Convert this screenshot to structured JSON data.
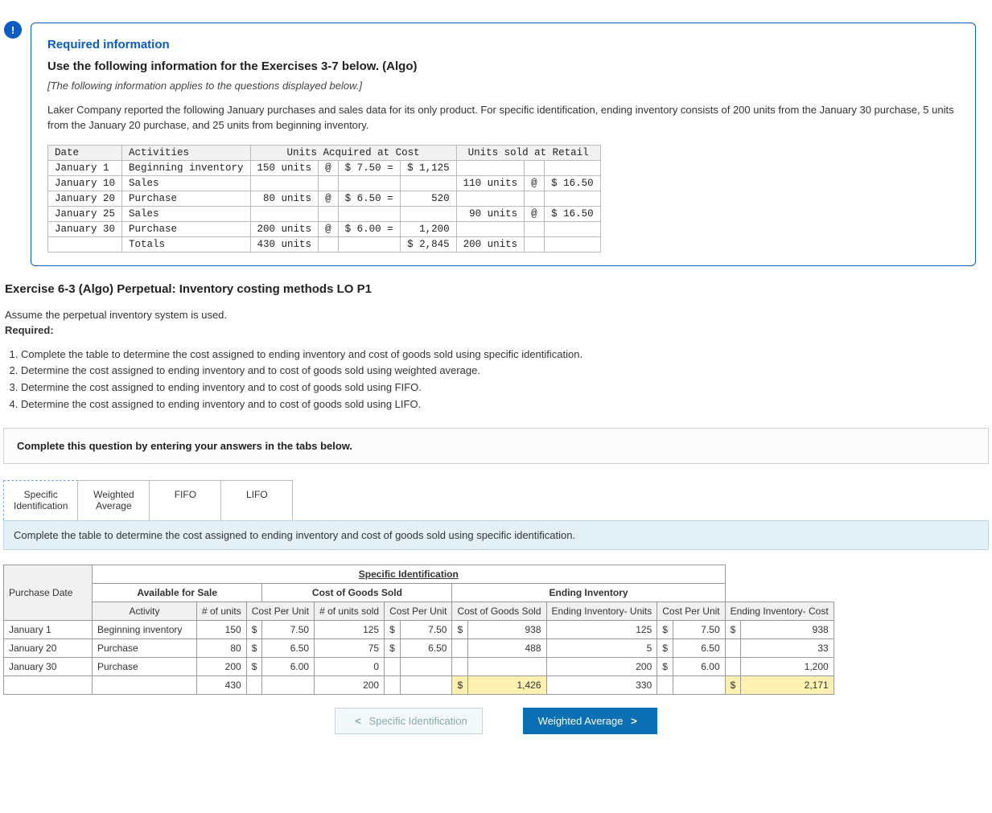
{
  "alert_glyph": "!",
  "info": {
    "required_title": "Required information",
    "use_line": "Use the following information for the Exercises 3-7 below. (Algo)",
    "italic_line": "[The following information applies to the questions displayed below.]",
    "body": "Laker Company reported the following January purchases and sales data for its only product. For specific identification, ending inventory consists of 200 units from the January 30 purchase, 5 units from the January 20 purchase, and 25 units from beginning inventory."
  },
  "source_table": {
    "head_date": "Date",
    "head_act": "Activities",
    "head_cost": "Units Acquired at Cost",
    "head_retail": "Units sold at Retail",
    "rows": [
      {
        "date": "January 1",
        "act": "Beginning inventory",
        "units": "150 units",
        "at": "@",
        "price": "$ 7.50 =",
        "total": "$ 1,125",
        "s_units": "",
        "s_at": "",
        "s_price": ""
      },
      {
        "date": "January 10",
        "act": "Sales",
        "units": "",
        "at": "",
        "price": "",
        "total": "",
        "s_units": "110 units",
        "s_at": "@",
        "s_price": "$ 16.50"
      },
      {
        "date": "January 20",
        "act": "Purchase",
        "units": "80 units",
        "at": "@",
        "price": "$ 6.50 =",
        "total": "520",
        "s_units": "",
        "s_at": "",
        "s_price": ""
      },
      {
        "date": "January 25",
        "act": "Sales",
        "units": "",
        "at": "",
        "price": "",
        "total": "",
        "s_units": "90 units",
        "s_at": "@",
        "s_price": "$ 16.50"
      },
      {
        "date": "January 30",
        "act": "Purchase",
        "units": "200 units",
        "at": "@",
        "price": "$ 6.00 =",
        "total": "1,200",
        "s_units": "",
        "s_at": "",
        "s_price": ""
      },
      {
        "date": "",
        "act": "Totals",
        "units": "430 units",
        "at": "",
        "price": "",
        "total": "$ 2,845",
        "s_units": "200 units",
        "s_at": "",
        "s_price": ""
      }
    ]
  },
  "exercise_title": "Exercise 6-3 (Algo) Perpetual: Inventory costing methods LO P1",
  "assume_line": "Assume the perpetual inventory system is used.",
  "required_label": "Required:",
  "requirements": [
    "Complete the table to determine the cost assigned to ending inventory and cost of goods sold using specific identification.",
    "Determine the cost assigned to ending inventory and to cost of goods sold using weighted average.",
    "Determine the cost assigned to ending inventory and to cost of goods sold using FIFO.",
    "Determine the cost assigned to ending inventory and to cost of goods sold using LIFO."
  ],
  "instr_bar": "Complete this question by entering your answers in the tabs below.",
  "tabs": [
    {
      "line1": "Specific",
      "line2": "Identification"
    },
    {
      "line1": "Weighted",
      "line2": "Average"
    },
    {
      "line1": "FIFO",
      "line2": ""
    },
    {
      "line1": "LIFO",
      "line2": ""
    }
  ],
  "tab_desc": "Complete the table to determine the cost assigned to ending inventory and cost of goods sold using specific identification.",
  "answer": {
    "title": "Specific Identification",
    "group_avail": "Available for Sale",
    "group_cogs": "Cost of Goods Sold",
    "group_end": "Ending Inventory",
    "col_purchase_date": "Purchase Date",
    "col_activity": "Activity",
    "col_units": "# of units",
    "col_cpu": "Cost Per Unit",
    "col_units_sold": "# of units sold",
    "col_cpu2": "Cost Per Unit",
    "col_cogs": "Cost of Goods Sold",
    "col_ei_units": "Ending Inventory- Units",
    "col_cpu3": "Cost Per Unit",
    "col_ei_cost": "Ending Inventory- Cost",
    "rows": [
      {
        "date": "January 1",
        "act": "Beginning inventory",
        "u": "150",
        "cpu_s": "$",
        "cpu": "7.50",
        "us": "125",
        "cpu2_s": "$",
        "cpu2": "7.50",
        "cogs_s": "$",
        "cogs": "938",
        "eu": "125",
        "cpu3_s": "$",
        "cpu3": "7.50",
        "ec_s": "$",
        "ec": "938",
        "yellow": false
      },
      {
        "date": "January 20",
        "act": "Purchase",
        "u": "80",
        "cpu_s": "$",
        "cpu": "6.50",
        "us": "75",
        "cpu2_s": "$",
        "cpu2": "6.50",
        "cogs_s": "",
        "cogs": "488",
        "eu": "5",
        "cpu3_s": "$",
        "cpu3": "6.50",
        "ec_s": "",
        "ec": "33",
        "yellow": false
      },
      {
        "date": "January 30",
        "act": "Purchase",
        "u": "200",
        "cpu_s": "$",
        "cpu": "6.00",
        "us": "0",
        "cpu2_s": "",
        "cpu2": "",
        "cogs_s": "",
        "cogs": "",
        "eu": "200",
        "cpu3_s": "$",
        "cpu3": "6.00",
        "ec_s": "",
        "ec": "1,200",
        "yellow": false
      },
      {
        "date": "",
        "act": "",
        "u": "430",
        "cpu_s": "",
        "cpu": "",
        "us": "200",
        "cpu2_s": "",
        "cpu2": "",
        "cogs_s": "$",
        "cogs": "1,426",
        "eu": "330",
        "cpu3_s": "",
        "cpu3": "",
        "ec_s": "$",
        "ec": "2,171",
        "yellow": true
      }
    ]
  },
  "nav": {
    "prev": "Specific Identification",
    "next": "Weighted Average"
  }
}
